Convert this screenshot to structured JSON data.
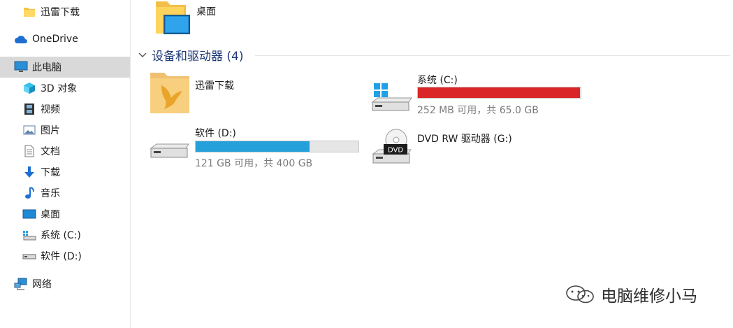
{
  "sidebar": {
    "items": [
      {
        "label": "迅雷下载",
        "icon": "folder-icon"
      },
      {
        "label": "OneDrive",
        "icon": "cloud-icon"
      },
      {
        "label": "此电脑",
        "icon": "computer-icon",
        "selected": true
      },
      {
        "label": "3D 对象",
        "icon": "cube-3d-icon"
      },
      {
        "label": "视频",
        "icon": "film-icon"
      },
      {
        "label": "图片",
        "icon": "picture-icon"
      },
      {
        "label": "文档",
        "icon": "document-icon"
      },
      {
        "label": "下载",
        "icon": "download-arrow-icon"
      },
      {
        "label": "音乐",
        "icon": "music-note-icon"
      },
      {
        "label": "桌面",
        "icon": "desktop-icon"
      },
      {
        "label": "系统 (C:)",
        "icon": "system-drive-icon"
      },
      {
        "label": "软件 (D:)",
        "icon": "drive-icon"
      },
      {
        "label": "网络",
        "icon": "network-icon"
      }
    ]
  },
  "main": {
    "top_folder": {
      "label": "桌面",
      "icon": "desktop-folder-icon"
    },
    "section": {
      "title": "设备和驱动器 (4)"
    },
    "drives": [
      {
        "name": "迅雷下载",
        "icon": "xunlei-folder-icon"
      },
      {
        "name": "系统 (C:)",
        "icon": "windows-drive-icon",
        "usage": "252 MB 可用，共 65.0 GB",
        "used_fraction": 0.996,
        "bar_color": "#da2626"
      },
      {
        "name": "软件 (D:)",
        "icon": "drive-icon",
        "usage": "121 GB 可用，共 400 GB",
        "used_fraction": 0.6975,
        "bar_color": "#26a0da"
      },
      {
        "name": "DVD RW 驱动器 (G:)",
        "icon": "dvd-drive-icon",
        "badge": "DVD"
      }
    ]
  },
  "watermark": {
    "text": "电脑维修小马",
    "icon": "wechat-icon"
  }
}
